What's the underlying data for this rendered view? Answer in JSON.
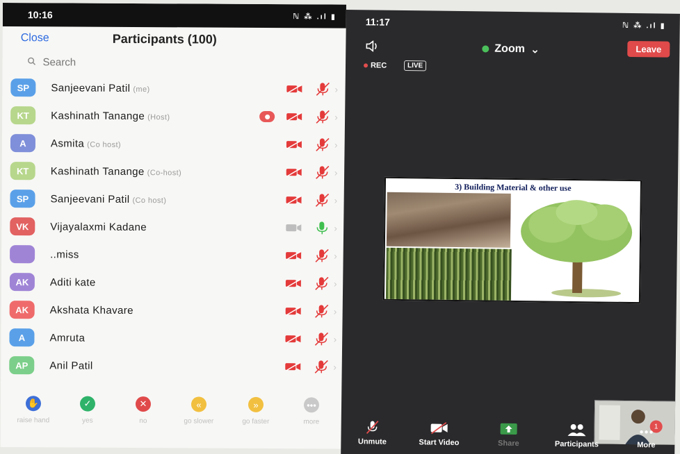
{
  "left": {
    "status_time": "10:16",
    "status_right": "ℕ ⁂ .ıl ▮",
    "close_label": "Close",
    "title": "Participants (100)",
    "search_placeholder": "Search",
    "participants": [
      {
        "initials": "SP",
        "name": "Sanjeevani Patil",
        "role": "(me)",
        "color": "#5aa0e8",
        "video": "off",
        "mic": "muted",
        "recording": false
      },
      {
        "initials": "KT",
        "name": "Kashinath Tanange",
        "role": "(Host)",
        "color": "#b7d78c",
        "video": "off",
        "mic": "muted",
        "recording": true
      },
      {
        "initials": "A",
        "name": "Asmita",
        "role": "(Co host)",
        "color": "#7f8fd9",
        "video": "off",
        "mic": "muted",
        "recording": false
      },
      {
        "initials": "KT",
        "name": "Kashinath Tanange",
        "role": "(Co-host)",
        "color": "#b7d78c",
        "video": "off",
        "mic": "muted",
        "recording": false
      },
      {
        "initials": "SP",
        "name": "Sanjeevani Patil",
        "role": "(Co host)",
        "color": "#5aa0e8",
        "video": "off",
        "mic": "muted",
        "recording": false
      },
      {
        "initials": "VK",
        "name": "Vijayalaxmi Kadane",
        "role": "",
        "color": "#e26161",
        "video": "inactive",
        "mic": "active",
        "recording": false
      },
      {
        "initials": "",
        "name": "..miss",
        "role": "",
        "color": "#9f84d6",
        "video": "off",
        "mic": "muted",
        "recording": false
      },
      {
        "initials": "AK",
        "name": "Aditi kate",
        "role": "",
        "color": "#9f84d6",
        "video": "off",
        "mic": "muted",
        "recording": false
      },
      {
        "initials": "AK",
        "name": "Akshata Khavare",
        "role": "",
        "color": "#ef6b6b",
        "video": "off",
        "mic": "muted",
        "recording": false
      },
      {
        "initials": "A",
        "name": "Amruta",
        "role": "",
        "color": "#5aa0e8",
        "video": "off",
        "mic": "muted",
        "recording": false
      },
      {
        "initials": "AP",
        "name": "Anil Patil",
        "role": "",
        "color": "#7ccf8a",
        "video": "off",
        "mic": "muted",
        "recording": false
      }
    ],
    "reactions": [
      {
        "label": "raise hand",
        "icon": "✋",
        "color": "#3d6fd8"
      },
      {
        "label": "yes",
        "icon": "✓",
        "color": "#2fb36a"
      },
      {
        "label": "no",
        "icon": "✕",
        "color": "#e04a4a"
      },
      {
        "label": "go slower",
        "icon": "«",
        "color": "#f2c040"
      },
      {
        "label": "go faster",
        "icon": "»",
        "color": "#f2c040"
      },
      {
        "label": "more",
        "icon": "•••",
        "color": "#c9c9c9"
      }
    ]
  },
  "right": {
    "status_time": "11:17",
    "status_right": "ℕ ⁂ .ıl ▮",
    "meeting_title": "Zoom",
    "leave_label": "Leave",
    "rec_label": "REC",
    "live_label": "LIVE",
    "slide_title": "3) Building Material & other use",
    "toolbar": [
      {
        "label": "Unmute",
        "icon": "mic-muted-icon",
        "dim": false
      },
      {
        "label": "Start Video",
        "icon": "video-off-icon",
        "dim": false
      },
      {
        "label": "Share",
        "icon": "share-icon",
        "dim": true
      },
      {
        "label": "Participants",
        "icon": "participants-icon",
        "dim": false
      },
      {
        "label": "More",
        "icon": "more-icon",
        "dim": false
      }
    ],
    "more_badge": "1"
  },
  "colors": {
    "muted_red": "#e43a3a",
    "zoom_blue": "#2d6ae0",
    "leave_red": "#e04a4a",
    "meeting_bg": "#2a2a2c"
  }
}
